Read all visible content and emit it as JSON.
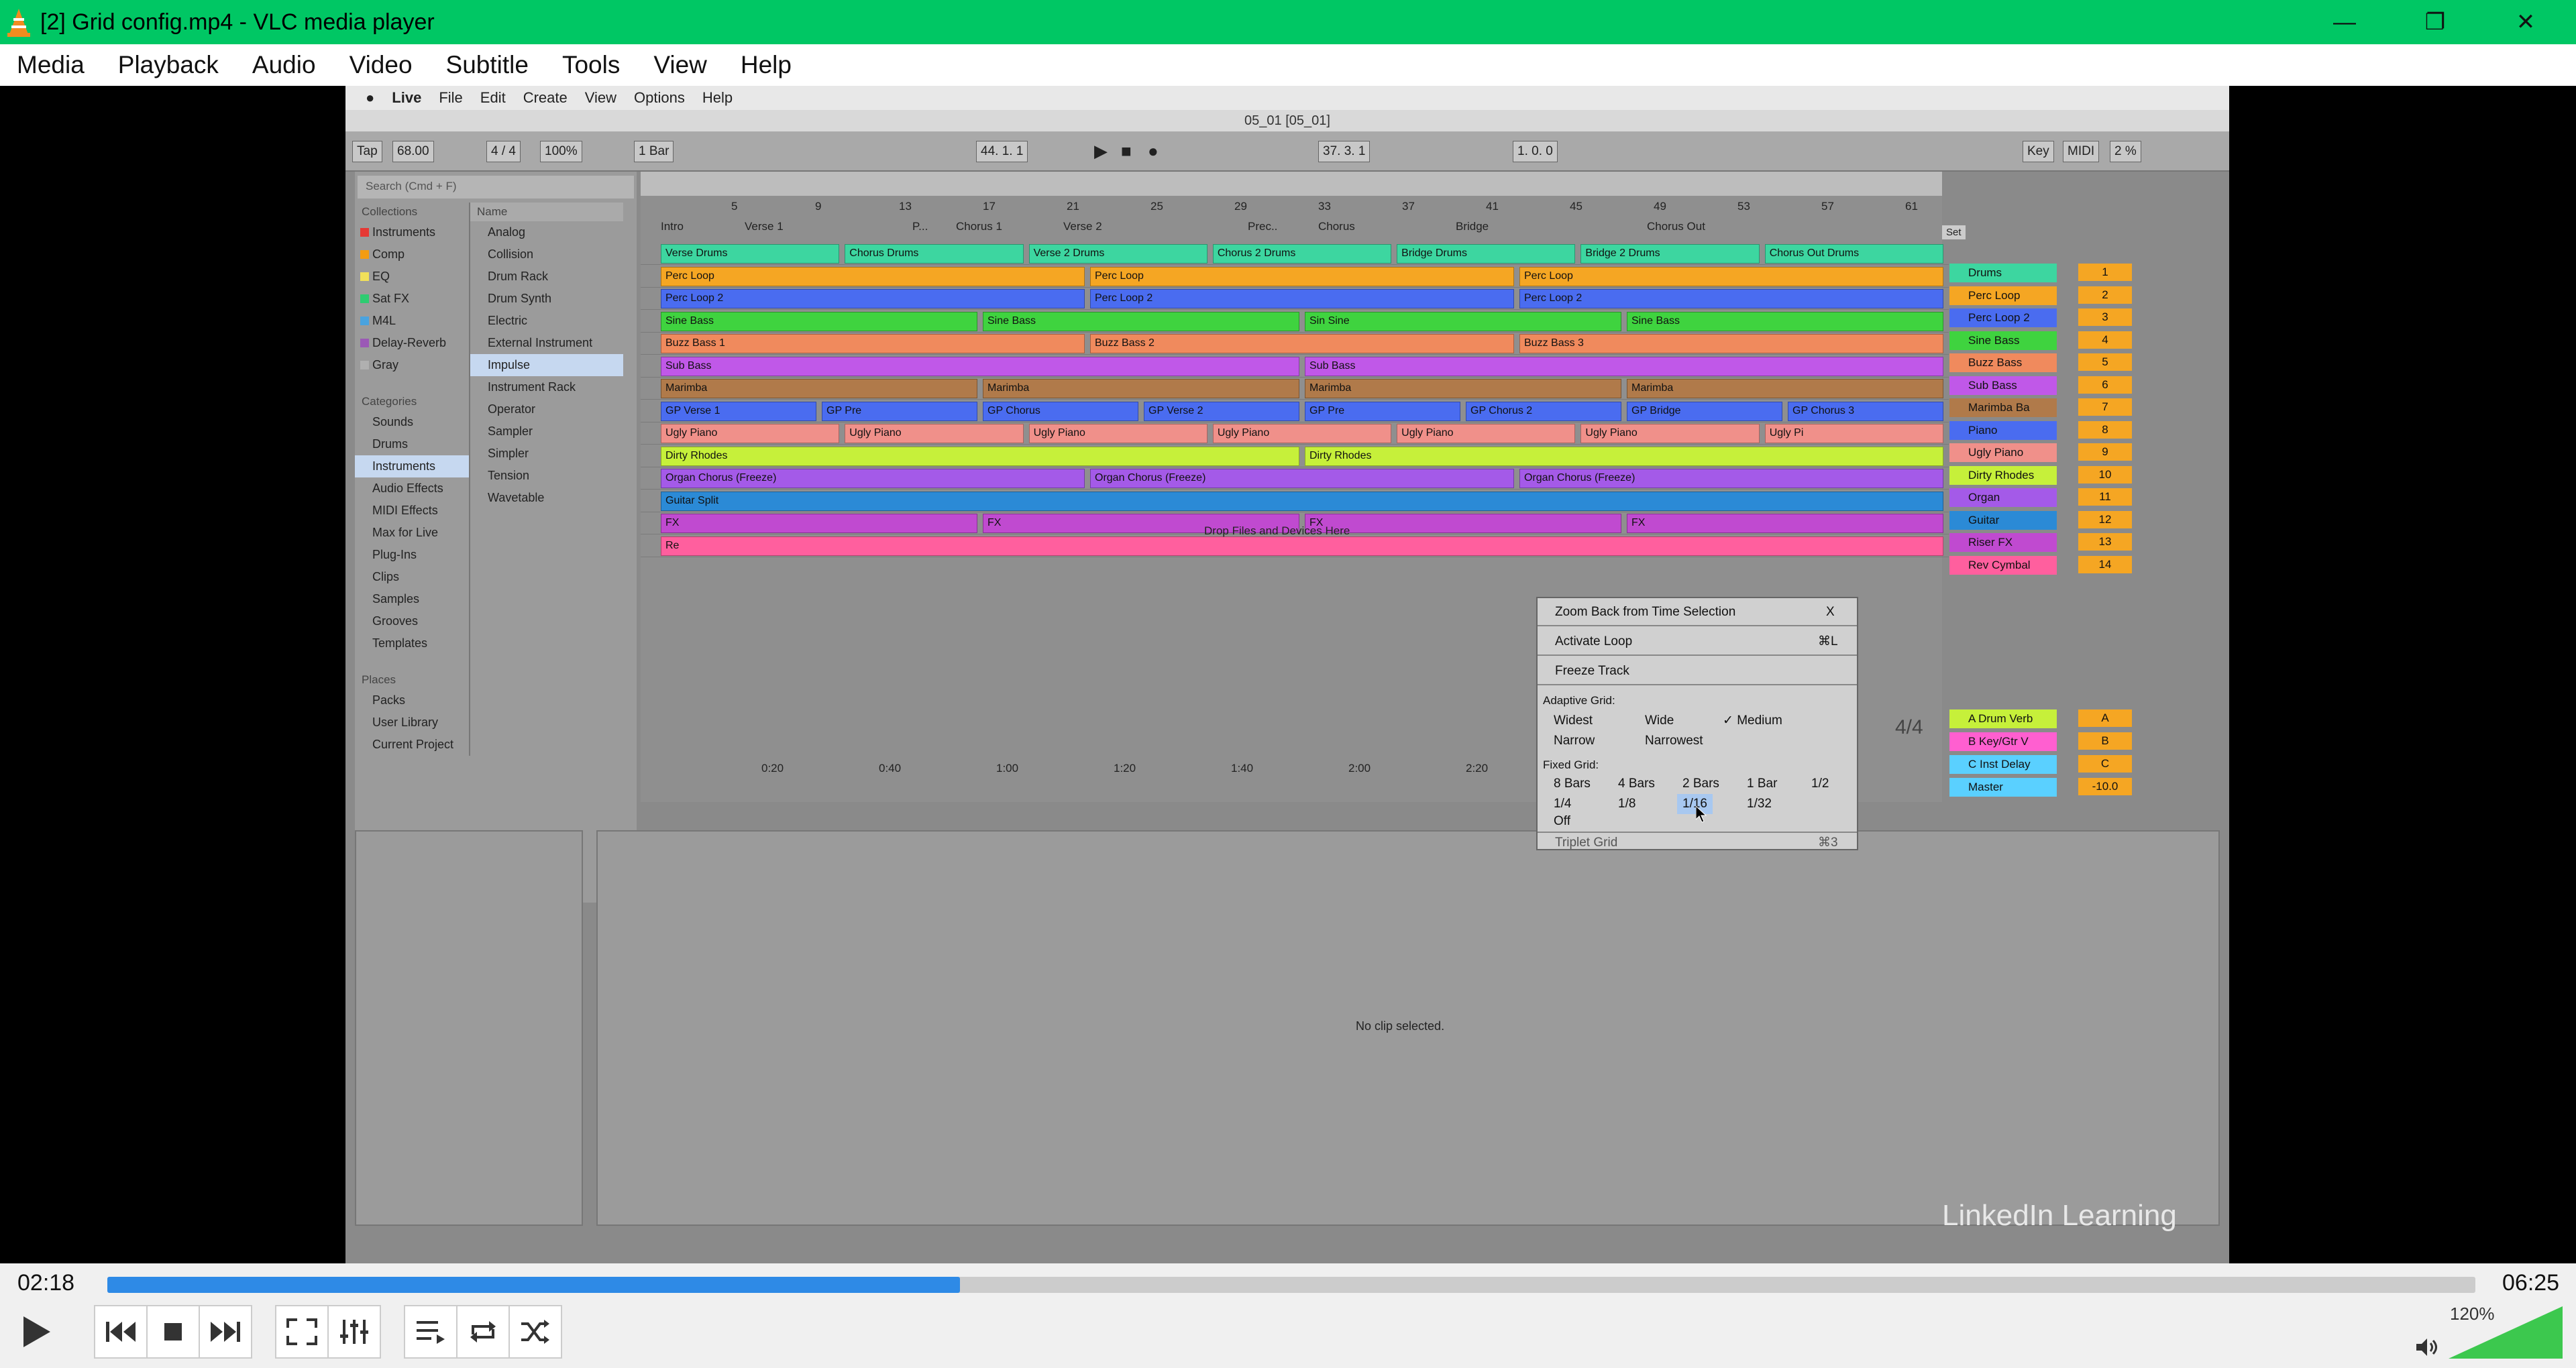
{
  "window": {
    "title": "[2] Grid config.mp4 - VLC media player",
    "minimize": "—",
    "maximize": "❐",
    "close": "✕",
    "accent": "#00c764"
  },
  "menubar": [
    "Media",
    "Playback",
    "Audio",
    "Video",
    "Subtitle",
    "Tools",
    "View",
    "Help"
  ],
  "live": {
    "mac_menu": [
      "Live",
      "File",
      "Edit",
      "Create",
      "View",
      "Options",
      "Help"
    ],
    "doc_title": "05_01  [05_01]",
    "transport": {
      "tap": "Tap",
      "tempo": "68.00",
      "sig": "4 / 4",
      "zoom": "100%",
      "quant": "1 Bar",
      "position": "44.  1.  1",
      "loop_start": "37.  3.  1",
      "loop_len": "1.  0.  0",
      "key": "Key",
      "midi": "MIDI",
      "cpu": "2 %"
    },
    "search_placeholder": "Search (Cmd + F)",
    "collections_header": "Collections",
    "collections": [
      {
        "label": "Instruments",
        "color": "#e53935"
      },
      {
        "label": "Comp",
        "color": "#f39c12"
      },
      {
        "label": "EQ",
        "color": "#f1e05a"
      },
      {
        "label": "Sat FX",
        "color": "#2ecc71"
      },
      {
        "label": "M4L",
        "color": "#4aa3df"
      },
      {
        "label": "Delay-Reverb",
        "color": "#9b59b6"
      },
      {
        "label": "Gray",
        "color": "#b0b0b0"
      }
    ],
    "categories_header": "Categories",
    "categories": [
      "Sounds",
      "Drums",
      "Instruments",
      "Audio Effects",
      "MIDI Effects",
      "Max for Live",
      "Plug-Ins",
      "Clips",
      "Samples",
      "Grooves",
      "Templates"
    ],
    "places_header": "Places",
    "places": [
      "Packs",
      "User Library",
      "Current Project"
    ],
    "name_header": "Name",
    "names": [
      "Analog",
      "Collision",
      "Drum Rack",
      "Drum Synth",
      "Electric",
      "External Instrument",
      "Impulse",
      "Instrument Rack",
      "Operator",
      "Sampler",
      "Simpler",
      "Tension",
      "Wavetable"
    ],
    "bars": [
      "5",
      "9",
      "13",
      "17",
      "21",
      "25",
      "29",
      "33",
      "37",
      "41",
      "45",
      "49",
      "53",
      "57",
      "61"
    ],
    "locators": [
      "Intro",
      "Verse 1",
      "P...",
      "Chorus 1",
      "Verse 2",
      "Prec..",
      "Chorus",
      "Bridge",
      "Chorus Out"
    ],
    "tracks": [
      {
        "name": "Drums",
        "num": "1",
        "color": "#3dd6a0",
        "clips": [
          "Verse Drums",
          "Chorus Drums",
          "Verse 2 Drums",
          "Chorus 2 Drums",
          "Bridge Drums",
          "Bridge 2 Drums",
          "Chorus Out Drums"
        ]
      },
      {
        "name": "Perc Loop",
        "num": "2",
        "color": "#f5a623",
        "clips": [
          "Perc Loop",
          "Perc Loop",
          "Perc Loop"
        ]
      },
      {
        "name": "Perc Loop 2",
        "num": "3",
        "color": "#4a6cf0",
        "clips": [
          "Perc Loop 2",
          "Perc Loop 2",
          "Perc Loop 2"
        ]
      },
      {
        "name": "Sine Bass",
        "num": "4",
        "color": "#3fd33f",
        "clips": [
          "Sine Bass",
          "Sine Bass",
          "Sin Sine",
          "Sine Bass"
        ]
      },
      {
        "name": "Buzz Bass",
        "num": "5",
        "color": "#f08a5d",
        "clips": [
          "Buzz Bass 1",
          "Buzz Bass 2",
          "Buzz Bass 3"
        ]
      },
      {
        "name": "Sub Bass",
        "num": "6",
        "color": "#c058e8",
        "clips": [
          "Sub Bass",
          "Sub Bass"
        ]
      },
      {
        "name": "Marimba Ba",
        "num": "7",
        "color": "#b07a4a",
        "clips": [
          "Marimba",
          "Marimba",
          "Marimba",
          "Marimba"
        ]
      },
      {
        "name": "Piano",
        "num": "8",
        "color": "#4a6cf0",
        "clips": [
          "GP Verse 1",
          "GP Pre",
          "GP Chorus",
          "GP Verse 2",
          "GP Pre",
          "GP Chorus 2",
          "GP Bridge",
          "GP Chorus 3"
        ]
      },
      {
        "name": "Ugly Piano",
        "num": "9",
        "color": "#f0908a",
        "clips": [
          "Ugly Piano",
          "Ugly Piano",
          "Ugly Piano",
          "Ugly Piano",
          "Ugly Piano",
          "Ugly Piano",
          "Ugly Pi"
        ]
      },
      {
        "name": "Dirty Rhodes",
        "num": "10",
        "color": "#c6f03a",
        "clips": [
          "Dirty Rhodes",
          "Dirty Rhodes"
        ]
      },
      {
        "name": "Organ",
        "num": "11",
        "color": "#a45ae8",
        "clips": [
          "Organ Chorus (Freeze)",
          "Organ Chorus (Freeze)",
          "Organ Chorus (Freeze)"
        ]
      },
      {
        "name": "Guitar",
        "num": "12",
        "color": "#2b8ad6",
        "clips": [
          "Guitar Split"
        ]
      },
      {
        "name": "Riser FX",
        "num": "13",
        "color": "#c04ad0",
        "clips": [
          "FX",
          "FX",
          "FX",
          "FX"
        ]
      },
      {
        "name": "Rev Cymbal",
        "num": "14",
        "color": "#ff5f9e",
        "clips": [
          "Re"
        ]
      }
    ],
    "returns": [
      {
        "name": "A Drum Verb",
        "letter": "A",
        "color": "#c6f03a"
      },
      {
        "name": "B Key/Gtr V",
        "letter": "B",
        "color": "#ff5fd0"
      },
      {
        "name": "C Inst Delay",
        "letter": "C",
        "color": "#5ad0ff"
      },
      {
        "name": "Master",
        "letter": "-10.0",
        "color": "#5ad0ff"
      }
    ],
    "drop_hint": "Drop Files and Devices Here",
    "times": [
      "0:20",
      "0:40",
      "1:00",
      "1:20",
      "1:40",
      "2:00",
      "2:20"
    ],
    "timesig_label": "4/4",
    "context_menu": {
      "zoom_back": "Zoom Back from Time Selection",
      "zoom_back_key": "X",
      "activate_loop": "Activate Loop",
      "activate_loop_key": "⌘L",
      "freeze": "Freeze Track",
      "adaptive_label": "Adaptive Grid:",
      "adaptive": [
        "Widest",
        "Wide",
        "✓ Medium",
        "Narrow",
        "Narrowest"
      ],
      "fixed_label": "Fixed Grid:",
      "fixed_row1": [
        "8 Bars",
        "4 Bars",
        "2 Bars",
        "1 Bar",
        "1/2"
      ],
      "fixed_row2": [
        "1/4",
        "1/8",
        "1/16",
        "1/32"
      ],
      "off": "Off",
      "triplet": "Triplet Grid",
      "triplet_key": "⌘3"
    },
    "no_clip": "No clip selected.",
    "set_label": "Set",
    "watermark": "LinkedIn Learning"
  },
  "player": {
    "current": "02:18",
    "total": "06:25",
    "progress": 0.36,
    "volume_pct": "120%",
    "volume_level": 1.0
  }
}
